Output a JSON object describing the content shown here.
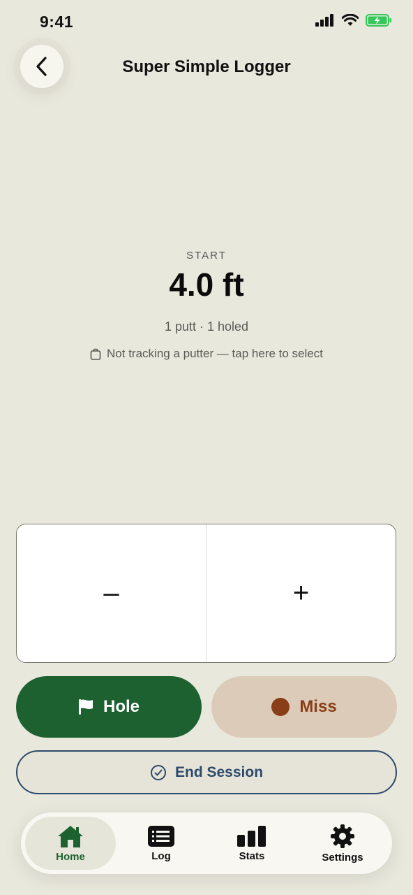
{
  "status_bar": {
    "time": "9:41"
  },
  "header": {
    "title": "Super Simple Logger"
  },
  "session": {
    "start_label": "START",
    "distance": "4.0 ft",
    "summary": "1 putt · 1 holed",
    "putter_note": "Not tracking a putter — tap here to select"
  },
  "stepper": {
    "decrement_label": "–",
    "increment_label": "+"
  },
  "actions": {
    "hole_label": "Hole",
    "miss_label": "Miss",
    "end_session_label": "End Session"
  },
  "tabs": [
    {
      "label": "Home",
      "icon": "home-icon",
      "active": true
    },
    {
      "label": "Log",
      "icon": "list-icon",
      "active": false
    },
    {
      "label": "Stats",
      "icon": "bar-chart-icon",
      "active": false
    },
    {
      "label": "Settings",
      "icon": "gear-icon",
      "active": false
    }
  ],
  "colors": {
    "background": "#e9e8dd",
    "hole_green": "#1e6131",
    "miss_brown": "#8a3e17",
    "miss_bg": "#dbcbb8",
    "end_session_blue": "#2d4a6a",
    "battery_green": "#34c759"
  }
}
